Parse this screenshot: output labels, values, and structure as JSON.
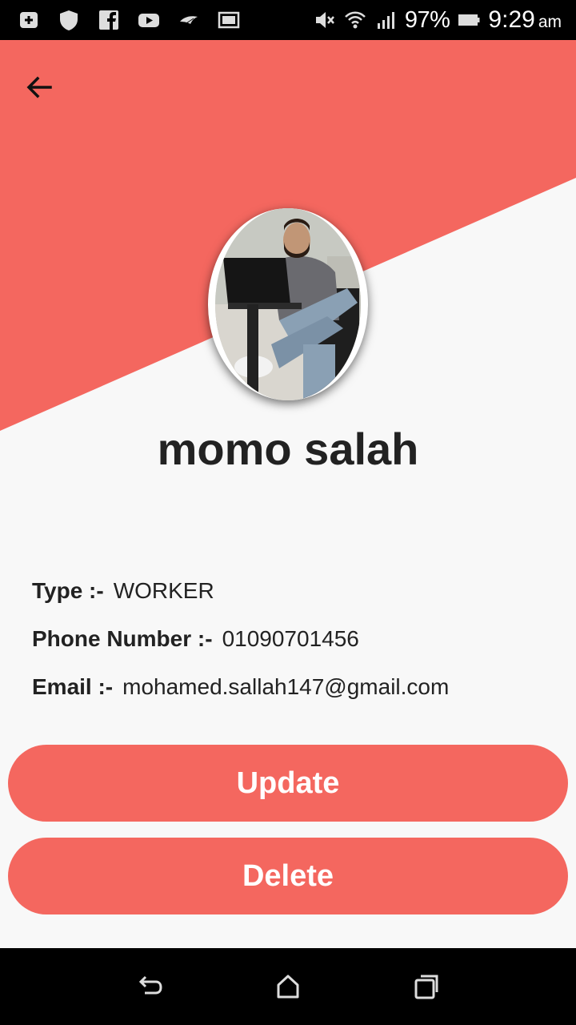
{
  "status_bar": {
    "icons_left": [
      "add-box-icon",
      "shield-icon",
      "facebook-icon",
      "youtube-icon",
      "bird-icon",
      "image-icon"
    ],
    "icons_right": [
      "mute-icon",
      "wifi-icon",
      "signal-icon",
      "battery-icon"
    ],
    "battery": "97%",
    "time": "9:29",
    "ampm": "am"
  },
  "colors": {
    "accent": "#f4675f",
    "background": "#f8f8f8",
    "text": "#222222"
  },
  "header": {
    "back_icon": "arrow-left-icon"
  },
  "profile": {
    "name": "momo salah",
    "type_label": "Type :-",
    "type_value": "WORKER",
    "phone_label": "Phone Number :-",
    "phone_value": "01090701456",
    "email_label": "Email :-",
    "email_value": "mohamed.sallah147@gmail.com"
  },
  "actions": {
    "update_label": "Update",
    "delete_label": "Delete"
  },
  "nav": {
    "back": "back-icon",
    "home": "home-icon",
    "recents": "recents-icon"
  }
}
